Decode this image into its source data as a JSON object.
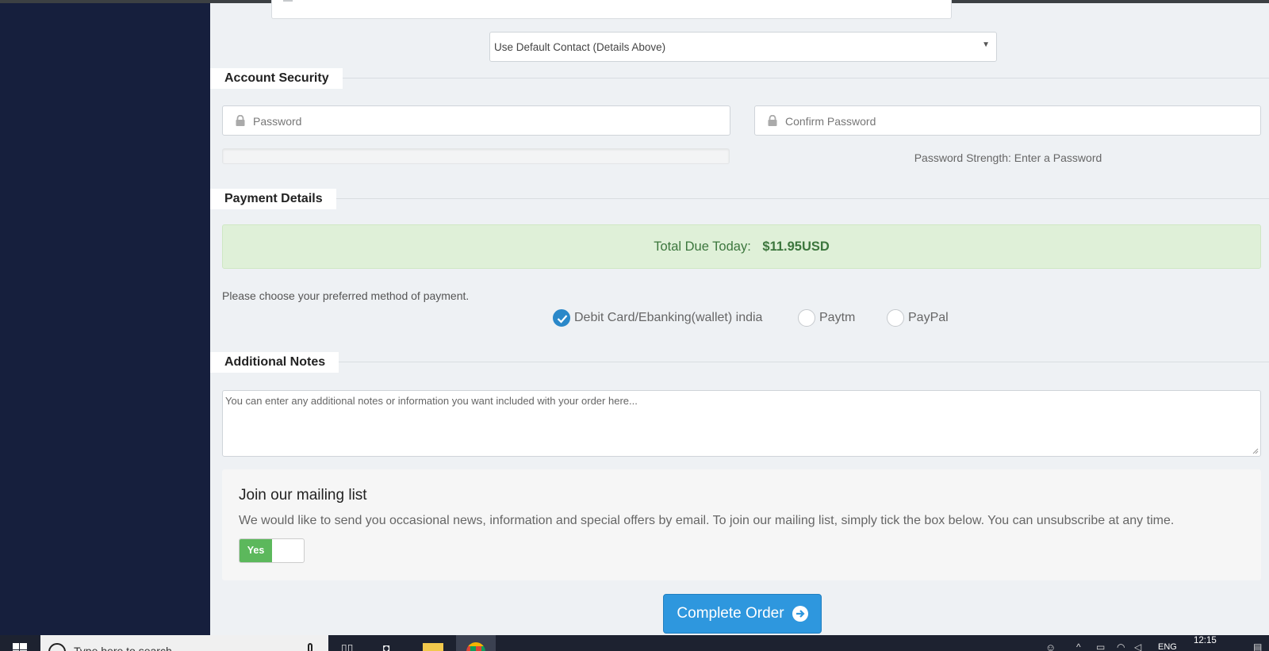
{
  "contact_select": {
    "value": "Use Default Contact (Details Above)"
  },
  "account_security": {
    "title": "Account Security",
    "password_placeholder": "Password",
    "confirm_placeholder": "Confirm Password",
    "strength_text": "Password Strength: Enter a Password"
  },
  "payment": {
    "title": "Payment Details",
    "total_label": "Total Due Today:",
    "total_amount": "$11.95USD",
    "instructions": "Please choose your preferred method of payment.",
    "methods": [
      {
        "label": "Debit Card/Ebanking(wallet) india",
        "checked": true
      },
      {
        "label": "Paytm",
        "checked": false
      },
      {
        "label": "PayPal",
        "checked": false
      }
    ]
  },
  "notes": {
    "title": "Additional Notes",
    "placeholder": "You can enter any additional notes or information you want included with your order here..."
  },
  "mailing": {
    "title": "Join our mailing list",
    "description": "We would like to send you occasional news, information and special offers by email. To join our mailing list, simply tick the box below. You can unsubscribe at any time.",
    "toggle_label": "Yes"
  },
  "complete_button": {
    "label": "Complete Order"
  },
  "taskbar": {
    "search_text": "Type here to search",
    "language": "ENG",
    "time": "12:15"
  },
  "colors": {
    "sidebar": "#161f3d",
    "accent": "#2e97de",
    "success_bg": "#dff0d8",
    "toggle_on": "#5cb85c"
  }
}
